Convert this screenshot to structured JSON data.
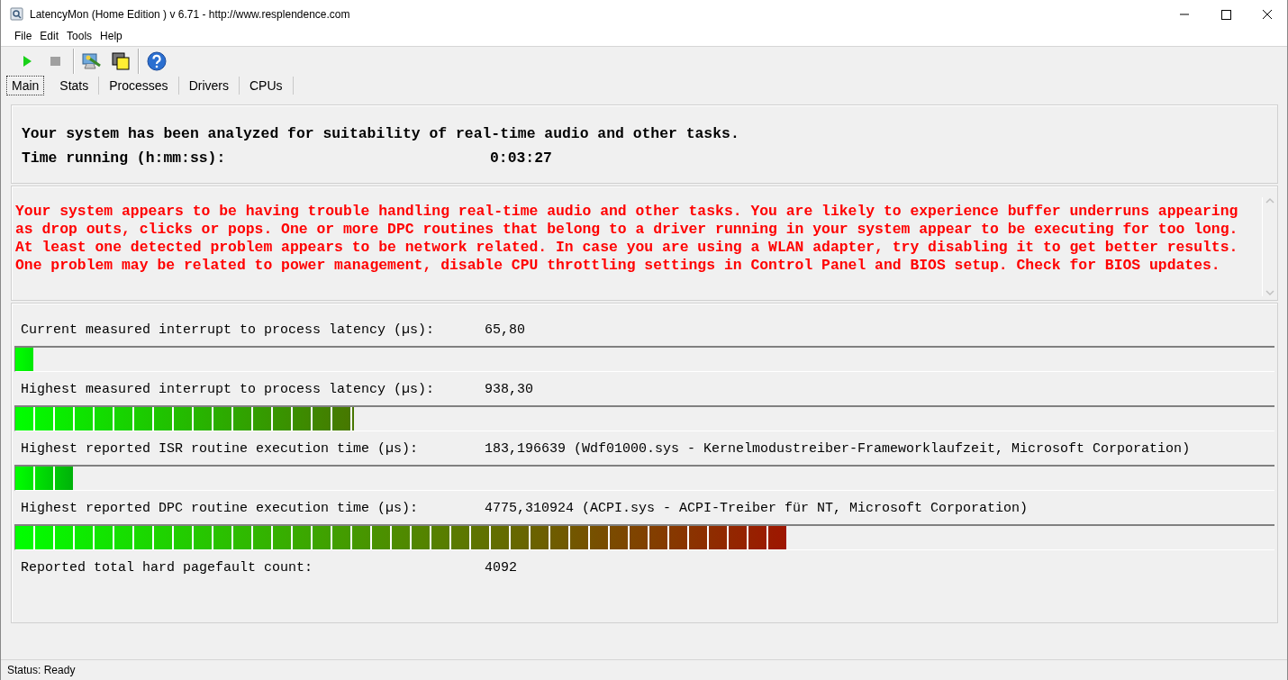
{
  "window": {
    "title": "LatencyMon  (Home Edition )  v 6.71 - http://www.resplendence.com"
  },
  "menu": [
    "File",
    "Edit",
    "Tools",
    "Help"
  ],
  "toolbar": [
    {
      "kind": "play",
      "disabled": false
    },
    {
      "kind": "stop",
      "disabled": true
    },
    {
      "kind": "sep"
    },
    {
      "kind": "monitor"
    },
    {
      "kind": "windows"
    },
    {
      "kind": "sep"
    },
    {
      "kind": "help"
    }
  ],
  "tabs": [
    {
      "label": "Main",
      "selected": true
    },
    {
      "label": "Stats",
      "selected": false
    },
    {
      "label": "Processes",
      "selected": false
    },
    {
      "label": "Drivers",
      "selected": false
    },
    {
      "label": "CPUs",
      "selected": false
    }
  ],
  "summary": {
    "heading": "Your system has been analyzed for suitability of real-time audio and other tasks.",
    "time_label": "Time running (h:mm:ss):",
    "time_value": "0:03:27"
  },
  "verdict": {
    "lines": [
      "Your system appears to be having trouble handling real-time audio and other tasks. You are likely to experience buffer underruns appearing",
      "as drop outs, clicks or pops. One or more DPC routines that belong to a driver running in your system appear to be executing for too long.",
      "At least one detected problem appears to be network related. In case you are using a WLAN adapter, try disabling it to get better results.",
      "One problem may be related to power management, disable CPU throttling settings in Control Panel and BIOS setup. Check for BIOS updates."
    ]
  },
  "measurements": [
    {
      "kind": "bar",
      "label": "Current measured interrupt to process latency (µs):",
      "value": "65,80",
      "level": 0.014
    },
    {
      "kind": "bar",
      "label": "Highest measured interrupt to process latency (µs):",
      "value": "938,30",
      "level": 0.269
    },
    {
      "kind": "bar",
      "label": "Highest reported ISR routine execution time (µs):",
      "value": "183,196639",
      "detail": "(Wdf01000.sys - Kernelmodustreiber-Frameworklaufzeit, Microsoft Corporation)",
      "level": 0.046
    },
    {
      "kind": "bar",
      "label": "Highest reported DPC routine execution time (µs):",
      "value": "4775,310924",
      "detail": "(ACPI.sys - ACPI-Treiber für NT, Microsoft Corporation)",
      "level": 0.612
    },
    {
      "kind": "text",
      "label": "Reported total hard pagefault count:",
      "value": "4092"
    }
  ],
  "status_bar": "Status: Ready"
}
